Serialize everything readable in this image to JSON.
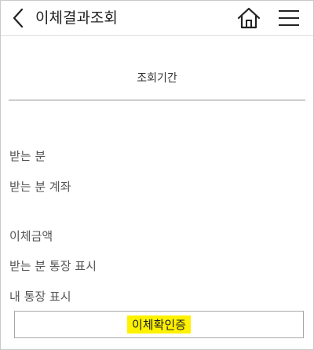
{
  "header": {
    "title": "이체결과조회"
  },
  "period_label": "조회기간",
  "details": {
    "recipient": "받는 분",
    "recipient_account": "받는 분 계좌",
    "amount": "이체금액",
    "recipient_passbook_memo": "받는 분 통장 표시",
    "my_passbook_memo": "내 통장 표시"
  },
  "confirm_button": {
    "label": "이체확인증",
    "highlight_color": "#fff200"
  },
  "icons": {
    "back": "chevron-left-icon",
    "home": "home-icon",
    "menu": "hamburger-menu-icon"
  }
}
